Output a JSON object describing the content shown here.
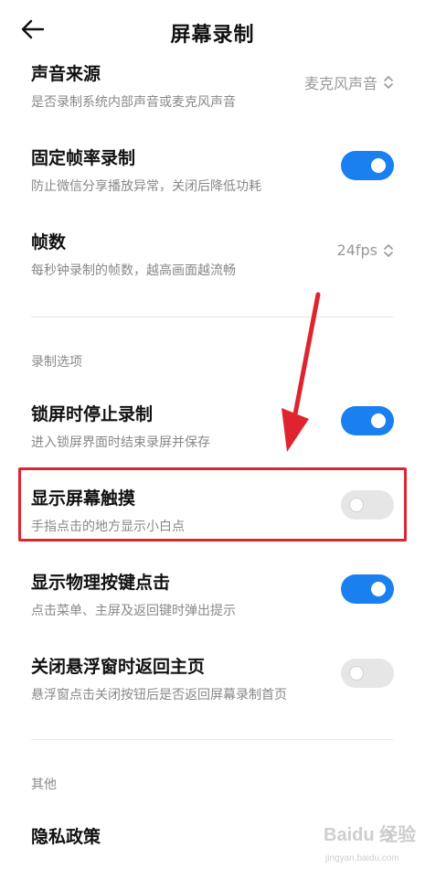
{
  "header": {
    "title": "屏幕录制"
  },
  "settings": {
    "sound_source": {
      "title": "声音来源",
      "subtitle": "是否录制系统内部声音或麦克风声音",
      "value": "麦克风声音"
    },
    "fixed_framerate": {
      "title": "固定帧率录制",
      "subtitle": "防止微信分享播放异常，关闭后降低功耗",
      "enabled": true
    },
    "fps": {
      "title": "帧数",
      "subtitle": "每秒钟录制的帧数，越高画面越流畅",
      "value": "24fps"
    }
  },
  "record_options": {
    "label": "录制选项",
    "items": [
      {
        "title": "锁屏时停止录制",
        "subtitle": "进入锁屏界面时结束录屏并保存",
        "enabled": true
      },
      {
        "title": "显示屏幕触摸",
        "subtitle": "手指点击的地方显示小白点",
        "enabled": false
      },
      {
        "title": "显示物理按键点击",
        "subtitle": "点击菜单、主屏及返回键时弹出提示",
        "enabled": true
      },
      {
        "title": "关闭悬浮窗时返回主页",
        "subtitle": "悬浮窗点击关闭按钮后是否返回屏幕录制首页",
        "enabled": false
      }
    ]
  },
  "other": {
    "label": "其他",
    "privacy": {
      "title": "隐私政策"
    }
  },
  "colors": {
    "toggle_on": "#1a7fef",
    "toggle_off": "#e6e6e6",
    "highlight": "#e0242f",
    "arrow": "#e0242f"
  },
  "icons": {
    "back": "arrow-left-icon",
    "select": "up-down-chevron-icon",
    "more": "chevron-right-icon"
  },
  "watermark": {
    "text": "Baidu 经验",
    "domain": "jingyan.baidu.com"
  }
}
